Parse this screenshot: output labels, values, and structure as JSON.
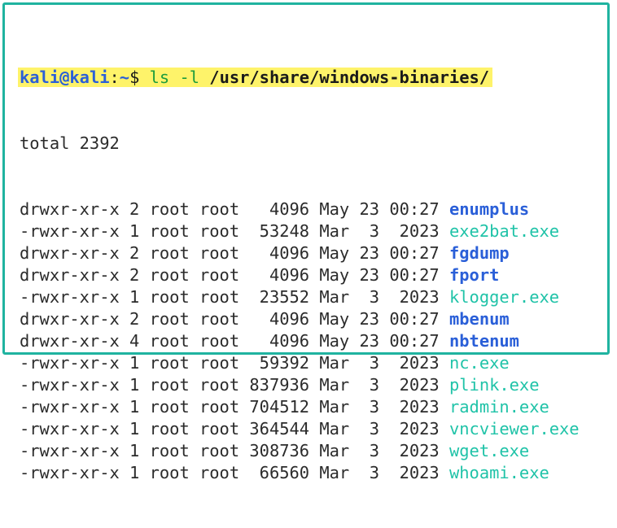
{
  "prompt": {
    "user": "kali",
    "at": "@",
    "host": "kali",
    "colon": ":",
    "cwd": "~",
    "symbol": "$",
    "command": "ls -l",
    "argument": "/usr/share/windows-binaries/"
  },
  "total_line": "total 2392",
  "entries": [
    {
      "perms": "drwxr-xr-x",
      "links": "2",
      "owner": "root",
      "group": "root",
      "size": "  4096",
      "month": "May",
      "day": "23",
      "time": "00:27",
      "name": "enumplus",
      "type": "dir"
    },
    {
      "perms": "-rwxr-xr-x",
      "links": "1",
      "owner": "root",
      "group": "root",
      "size": " 53248",
      "month": "Mar",
      "day": " 3",
      "time": " 2023",
      "name": "exe2bat.exe",
      "type": "exe"
    },
    {
      "perms": "drwxr-xr-x",
      "links": "2",
      "owner": "root",
      "group": "root",
      "size": "  4096",
      "month": "May",
      "day": "23",
      "time": "00:27",
      "name": "fgdump",
      "type": "dir"
    },
    {
      "perms": "drwxr-xr-x",
      "links": "2",
      "owner": "root",
      "group": "root",
      "size": "  4096",
      "month": "May",
      "day": "23",
      "time": "00:27",
      "name": "fport",
      "type": "dir"
    },
    {
      "perms": "-rwxr-xr-x",
      "links": "1",
      "owner": "root",
      "group": "root",
      "size": " 23552",
      "month": "Mar",
      "day": " 3",
      "time": " 2023",
      "name": "klogger.exe",
      "type": "exe"
    },
    {
      "perms": "drwxr-xr-x",
      "links": "2",
      "owner": "root",
      "group": "root",
      "size": "  4096",
      "month": "May",
      "day": "23",
      "time": "00:27",
      "name": "mbenum",
      "type": "dir"
    },
    {
      "perms": "drwxr-xr-x",
      "links": "4",
      "owner": "root",
      "group": "root",
      "size": "  4096",
      "month": "May",
      "day": "23",
      "time": "00:27",
      "name": "nbtenum",
      "type": "dir"
    },
    {
      "perms": "-rwxr-xr-x",
      "links": "1",
      "owner": "root",
      "group": "root",
      "size": " 59392",
      "month": "Mar",
      "day": " 3",
      "time": " 2023",
      "name": "nc.exe",
      "type": "exe"
    },
    {
      "perms": "-rwxr-xr-x",
      "links": "1",
      "owner": "root",
      "group": "root",
      "size": "837936",
      "month": "Mar",
      "day": " 3",
      "time": " 2023",
      "name": "plink.exe",
      "type": "exe"
    },
    {
      "perms": "-rwxr-xr-x",
      "links": "1",
      "owner": "root",
      "group": "root",
      "size": "704512",
      "month": "Mar",
      "day": " 3",
      "time": " 2023",
      "name": "radmin.exe",
      "type": "exe"
    },
    {
      "perms": "-rwxr-xr-x",
      "links": "1",
      "owner": "root",
      "group": "root",
      "size": "364544",
      "month": "Mar",
      "day": " 3",
      "time": " 2023",
      "name": "vncviewer.exe",
      "type": "exe"
    },
    {
      "perms": "-rwxr-xr-x",
      "links": "1",
      "owner": "root",
      "group": "root",
      "size": "308736",
      "month": "Mar",
      "day": " 3",
      "time": " 2023",
      "name": "wget.exe",
      "type": "exe"
    },
    {
      "perms": "-rwxr-xr-x",
      "links": "1",
      "owner": "root",
      "group": "root",
      "size": " 66560",
      "month": "Mar",
      "day": " 3",
      "time": " 2023",
      "name": "whoami.exe",
      "type": "exe"
    }
  ],
  "colors": {
    "frame_border": "#1fb3a0",
    "prompt_highlight": "#fef36a",
    "directory": "#2a5fd8",
    "executable": "#20c3a8",
    "command": "#1c9c3c"
  }
}
